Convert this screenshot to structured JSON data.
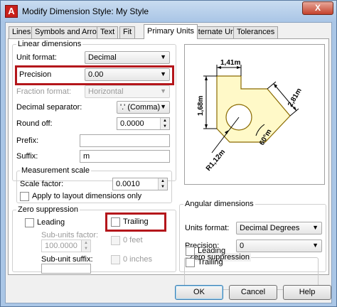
{
  "window": {
    "title": "Modify Dimension Style: My Style",
    "app_icon_letter": "A",
    "close_glyph": "X"
  },
  "tabs": [
    {
      "label": "Lines"
    },
    {
      "label": "Symbols and Arrows"
    },
    {
      "label": "Text"
    },
    {
      "label": "Fit"
    },
    {
      "label": "Primary Units",
      "active": true
    },
    {
      "label": "Alternate Units"
    },
    {
      "label": "Tolerances"
    }
  ],
  "linear": {
    "title": "Linear dimensions",
    "unit_format_label": "Unit format:",
    "unit_format_value": "Decimal",
    "precision_label": "Precision",
    "precision_value": "0.00",
    "fraction_label": "Fraction format:",
    "fraction_value": "Horizontal",
    "decimal_sep_label": "Decimal separator:",
    "decimal_sep_value": "'.' (Comma)",
    "round_off_label": "Round off:",
    "round_off_value": "0.0000",
    "prefix_label": "Prefix:",
    "prefix_value": "",
    "suffix_label": "Suffix:",
    "suffix_value": "m"
  },
  "measurement": {
    "title": "Measurement scale",
    "scale_label": "Scale factor:",
    "scale_value": "0.0010",
    "apply_layout_label": "Apply to layout dimensions only",
    "apply_layout_checked": false
  },
  "zero_suppression": {
    "title": "Zero suppression",
    "leading_label": "Leading",
    "leading_checked": false,
    "trailing_label": "Trailing",
    "trailing_checked": false,
    "sub_units_factor_label": "Sub-units factor:",
    "sub_units_factor_value": "100.0000",
    "zero_feet_label": "0 feet",
    "sub_unit_suffix_label": "Sub-unit suffix:",
    "sub_unit_suffix_value": "",
    "zero_inches_label": "0 inches"
  },
  "preview": {
    "dim_top": "1,41m",
    "dim_left": "1,68m",
    "dim_right": "2,81m",
    "dim_angle": "60°m",
    "dim_radius": "R1,12m"
  },
  "angular": {
    "title": "Angular dimensions",
    "units_format_label": "Units format:",
    "units_format_value": "Decimal Degrees",
    "precision_label": "Precision:",
    "precision_value": "0",
    "zero_title": "Zero suppression",
    "leading_label": "Leading",
    "leading_checked": false,
    "trailing_label": "Trailing",
    "trailing_checked": false
  },
  "buttons": {
    "ok": "OK",
    "cancel": "Cancel",
    "help": "Help"
  },
  "colors": {
    "highlight": "#b4161b",
    "preview_fill": "#fff9c8",
    "preview_outline": "#8a6a00"
  }
}
